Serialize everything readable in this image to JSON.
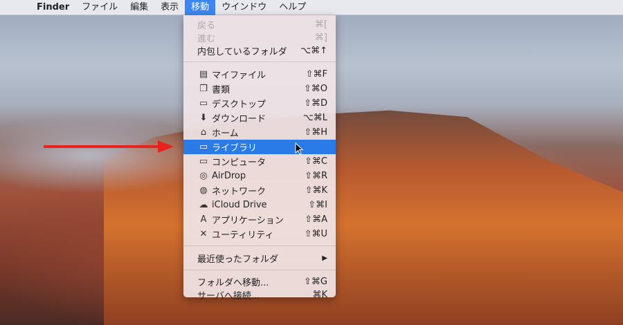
{
  "menubar": {
    "apple": "",
    "app": "Finder",
    "items": [
      "ファイル",
      "編集",
      "表示",
      "移動",
      "ウインドウ",
      "ヘルプ"
    ],
    "selected": "移動"
  },
  "menu": {
    "top": [
      {
        "label": "戻る",
        "shortcut": "⌘[",
        "disabled": true
      },
      {
        "label": "進む",
        "shortcut": "⌘]",
        "disabled": true
      },
      {
        "label": "内包しているフォルダ",
        "shortcut": "⌥⌘↑"
      }
    ],
    "places": [
      {
        "label": "マイファイル",
        "shortcut": "⇧⌘F",
        "icon": "all-my-files-icon"
      },
      {
        "label": "書類",
        "shortcut": "⇧⌘O",
        "icon": "documents-icon"
      },
      {
        "label": "デスクトップ",
        "shortcut": "⇧⌘D",
        "icon": "desktop-icon"
      },
      {
        "label": "ダウンロード",
        "shortcut": "⌥⌘L",
        "icon": "download-icon"
      },
      {
        "label": "ホーム",
        "shortcut": "⇧⌘H",
        "icon": "home-icon"
      },
      {
        "label": "ライブラリ",
        "shortcut": "",
        "icon": "folder-icon",
        "highlighted": true
      },
      {
        "label": "コンピュータ",
        "shortcut": "⇧⌘C",
        "icon": "computer-icon"
      },
      {
        "label": "AirDrop",
        "shortcut": "⇧⌘R",
        "icon": "airdrop-icon"
      },
      {
        "label": "ネットワーク",
        "shortcut": "⇧⌘K",
        "icon": "network-icon"
      },
      {
        "label": "iCloud Drive",
        "shortcut": "⇧⌘I",
        "icon": "cloud-icon"
      },
      {
        "label": "アプリケーション",
        "shortcut": "⇧⌘A",
        "icon": "applications-icon"
      },
      {
        "label": "ユーティリティ",
        "shortcut": "⇧⌘U",
        "icon": "utilities-icon"
      }
    ],
    "recent": {
      "label": "最近使ったフォルダ",
      "shortcut": "▶"
    },
    "bottom": [
      {
        "label": "フォルダへ移動...",
        "shortcut": "⇧⌘G"
      },
      {
        "label": "サーバへ接続...",
        "shortcut": "⌘K"
      }
    ]
  },
  "colors": {
    "highlight": "#2a7be8",
    "arrow": "#e8231e"
  }
}
